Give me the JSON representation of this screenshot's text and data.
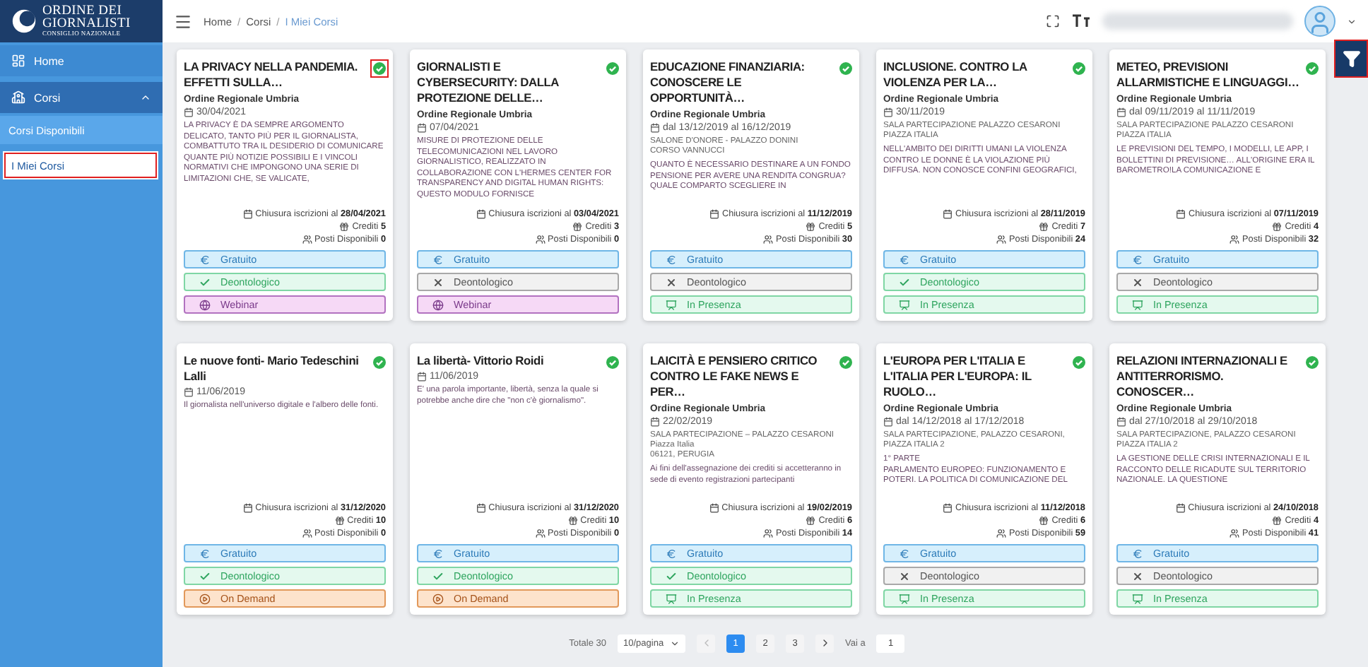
{
  "logo": {
    "lines": [
      "ORDINE DEI",
      "GIORNALISTI",
      "CONSIGLIO NAZIONALE"
    ]
  },
  "sidebar": {
    "items": [
      {
        "kind": "home",
        "label": "Home"
      },
      {
        "kind": "courses",
        "label": "Corsi",
        "expanded": true,
        "children": [
          {
            "label": "Corsi Disponibili",
            "selected": false,
            "highlighted": false
          },
          {
            "label": "I Miei Corsi",
            "selected": true,
            "highlighted": true
          }
        ]
      }
    ]
  },
  "breadcrumb": {
    "separators": [
      "/",
      "/"
    ],
    "items": [
      {
        "label": "Home",
        "current": false
      },
      {
        "label": "Corsi",
        "current": false
      },
      {
        "label": "I Miei Corsi",
        "current": true
      }
    ]
  },
  "filter_button": {
    "highlighted": true
  },
  "cards": [
    {
      "title": "LA PRIVACY NELLA PANDEMIA. EFFETTI SULLA…",
      "completed": true,
      "status_highlighted": true,
      "org": "Ordine Regionale Umbria",
      "date": "30/04/2021",
      "description": "LA PRIVACY È DA SEMPRE ARGOMENTO DELICATO, TANTO PIÙ PER IL GIORNALISTA, COMBATTUTO TRA IL DESIDERIO DI COMUNICARE QUANTE PIÙ NOTIZIE POSSIBILI E I VINCOLI NORMATIVI CHE IMPONGONO UNA SERIE DI LIMITAZIONI CHE, SE VALICATE,",
      "closing_label": "Chiusura iscrizioni al",
      "closing": "28/04/2021",
      "credits_label": "Crediti",
      "credits": "5",
      "seats_label": "Posti Disponibili",
      "seats": "0",
      "tags": [
        {
          "kind": "price",
          "label": "Gratuito"
        },
        {
          "kind": "deontologico",
          "label": "Deontologico",
          "checked": true
        },
        {
          "kind": "webinar",
          "label": "Webinar"
        }
      ]
    },
    {
      "title": "GIORNALISTI E CYBERSECURITY: DALLA PROTEZIONE DELLE…",
      "completed": true,
      "status_highlighted": false,
      "org": "Ordine Regionale Umbria",
      "date": "07/04/2021",
      "description": "MISURE DI PROTEZIONE DELLE TELECOMUNICAZIONI NEL LAVORO GIORNALISTICO, REALIZZATO IN COLLABORAZIONE CON L'HERMES CENTER FOR TRANSPARENCY AND DIGITAL HUMAN RIGHTS: QUESTO MODULO FORNISCE",
      "closing_label": "Chiusura iscrizioni al",
      "closing": "03/04/2021",
      "credits_label": "Crediti",
      "credits": "3",
      "seats_label": "Posti Disponibili",
      "seats": "0",
      "tags": [
        {
          "kind": "price",
          "label": "Gratuito"
        },
        {
          "kind": "deontologico",
          "label": "Deontologico",
          "checked": false
        },
        {
          "kind": "webinar",
          "label": "Webinar"
        }
      ]
    },
    {
      "title": "EDUCAZIONE FINANZIARIA: CONOSCERE LE OPPORTUNITÀ…",
      "completed": true,
      "status_highlighted": false,
      "org": "Ordine Regionale Umbria",
      "date": "dal 13/12/2019 al 16/12/2019",
      "location": [
        "SALONE D'ONORE - PALAZZO DONINI",
        "CORSO VANNUCCI"
      ],
      "description": "QUANTO È NECESSARIO DESTINARE A UN FONDO PENSIONE PER AVERE UNA RENDITA CONGRUA? QUALE COMPARTO SCEGLIERE IN",
      "closing_label": "Chiusura iscrizioni al",
      "closing": "11/12/2019",
      "credits_label": "Crediti",
      "credits": "5",
      "seats_label": "Posti Disponibili",
      "seats": "30",
      "tags": [
        {
          "kind": "price",
          "label": "Gratuito"
        },
        {
          "kind": "deontologico",
          "label": "Deontologico",
          "checked": false
        },
        {
          "kind": "presence",
          "label": "In Presenza"
        }
      ]
    },
    {
      "title": "INCLUSIONE. CONTRO LA VIOLENZA PER LA…",
      "completed": true,
      "status_highlighted": false,
      "org": "Ordine Regionale Umbria",
      "date": "30/11/2019",
      "location": [
        "SALA PARTECIPAZIONE PALAZZO CESARONI",
        "PIAZZA ITALIA"
      ],
      "description": "NELL'AMBITO DEI DIRITTI UMANI LA VIOLENZA CONTRO LE DONNE È LA VIOLAZIONE PIÙ DIFFUSA. NON CONOSCE CONFINI GEOGRAFICI,",
      "closing_label": "Chiusura iscrizioni al",
      "closing": "28/11/2019",
      "credits_label": "Crediti",
      "credits": "7",
      "seats_label": "Posti Disponibili",
      "seats": "24",
      "tags": [
        {
          "kind": "price",
          "label": "Gratuito"
        },
        {
          "kind": "deontologico",
          "label": "Deontologico",
          "checked": true
        },
        {
          "kind": "presence",
          "label": "In Presenza"
        }
      ]
    },
    {
      "title": "METEO, PREVISIONI ALLARMISTICHE E LINGUAGGI…",
      "completed": true,
      "status_highlighted": false,
      "org": "Ordine Regionale Umbria",
      "date": "dal 09/11/2019 al 11/11/2019",
      "location": [
        "SALA PARTECIPAZIONE PALAZZO CESARONI",
        "PIAZZA ITALIA"
      ],
      "description": "LE PREVISIONI DEL TEMPO, I MODELLI, LE APP, I BOLLETTINI DI PREVISIONE… ALL'ORIGINE ERA IL BAROMETRO!LA COMUNICAZIONE E",
      "closing_label": "Chiusura iscrizioni al",
      "closing": "07/11/2019",
      "credits_label": "Crediti",
      "credits": "4",
      "seats_label": "Posti Disponibili",
      "seats": "32",
      "tags": [
        {
          "kind": "price",
          "label": "Gratuito"
        },
        {
          "kind": "deontologico",
          "label": "Deontologico",
          "checked": false
        },
        {
          "kind": "presence",
          "label": "In Presenza"
        }
      ]
    },
    {
      "title": "Le nuove fonti- Mario Tedeschini Lalli",
      "completed": true,
      "status_highlighted": false,
      "date": "11/06/2019",
      "description": "Il giornalista nell'universo digitale e l'albero delle fonti.",
      "closing_label": "Chiusura iscrizioni al",
      "closing": "31/12/2020",
      "credits_label": "Crediti",
      "credits": "10",
      "seats_label": "Posti Disponibili",
      "seats": "0",
      "tags": [
        {
          "kind": "price",
          "label": "Gratuito"
        },
        {
          "kind": "deontologico",
          "label": "Deontologico",
          "checked": true
        },
        {
          "kind": "ondemand",
          "label": "On Demand"
        }
      ]
    },
    {
      "title": "La libertà- Vittorio Roidi",
      "completed": true,
      "status_highlighted": false,
      "date": "11/06/2019",
      "description": "E' una parola importante, libertà, senza la quale si potrebbe anche dire che \"non c'è giornalismo\".",
      "closing_label": "Chiusura iscrizioni al",
      "closing": "31/12/2020",
      "credits_label": "Crediti",
      "credits": "10",
      "seats_label": "Posti Disponibili",
      "seats": "0",
      "tags": [
        {
          "kind": "price",
          "label": "Gratuito"
        },
        {
          "kind": "deontologico",
          "label": "Deontologico",
          "checked": true
        },
        {
          "kind": "ondemand",
          "label": "On Demand"
        }
      ]
    },
    {
      "title": "LAICITÀ E PENSIERO CRITICO CONTRO LE FAKE NEWS E PER…",
      "completed": true,
      "status_highlighted": false,
      "org": "Ordine Regionale Umbria",
      "date": "22/02/2019",
      "location": [
        "SALA PARTECIPAZIONE – PALAZZO CESARONI",
        "Piazza Italia",
        "06121, PERUGIA"
      ],
      "description": "Ai fini dell'assegnazione dei crediti si accetteranno in sede di evento registrazioni partecipanti",
      "closing_label": "Chiusura iscrizioni al",
      "closing": "19/02/2019",
      "credits_label": "Crediti",
      "credits": "6",
      "seats_label": "Posti Disponibili",
      "seats": "14",
      "tags": [
        {
          "kind": "price",
          "label": "Gratuito"
        },
        {
          "kind": "deontologico",
          "label": "Deontologico",
          "checked": true
        },
        {
          "kind": "presence",
          "label": "In Presenza"
        }
      ]
    },
    {
      "title": "L'EUROPA PER L'ITALIA E L'ITALIA PER L'EUROPA: IL RUOLO…",
      "completed": true,
      "status_highlighted": false,
      "org": "Ordine Regionale Umbria",
      "date": "dal 14/12/2018 al 17/12/2018",
      "location": [
        "SALA PARTECIPAZIONE, PALAZZO CESARONI,",
        "PIAZZA ITALIA 2"
      ],
      "description": "1° PARTE\nPARLAMENTO EUROPEO: FUNZIONAMENTO E POTERI. LA POLITICA DI COMUNICAZIONE DEL",
      "closing_label": "Chiusura iscrizioni al",
      "closing": "11/12/2018",
      "credits_label": "Crediti",
      "credits": "6",
      "seats_label": "Posti Disponibili",
      "seats": "59",
      "tags": [
        {
          "kind": "price",
          "label": "Gratuito"
        },
        {
          "kind": "deontologico",
          "label": "Deontologico",
          "checked": false
        },
        {
          "kind": "presence",
          "label": "In Presenza"
        }
      ]
    },
    {
      "title": "RELAZIONI INTERNAZIONALI E ANTITERRORISMO. CONOSCER…",
      "completed": true,
      "status_highlighted": false,
      "org": "Ordine Regionale Umbria",
      "date": "dal 27/10/2018 al 29/10/2018",
      "location": [
        "SALA PARTECIPAZIONE, PALAZZO CESARONI",
        "PIAZZA ITALIA 2"
      ],
      "description": "LA GESTIONE DELLE CRISI INTERNAZIONALI E IL RACCONTO DELLE RICADUTE SUL TERRITORIO NAZIONALE. LA QUESTIONE",
      "closing_label": "Chiusura iscrizioni al",
      "closing": "24/10/2018",
      "credits_label": "Crediti",
      "credits": "4",
      "seats_label": "Posti Disponibili",
      "seats": "41",
      "tags": [
        {
          "kind": "price",
          "label": "Gratuito"
        },
        {
          "kind": "deontologico",
          "label": "Deontologico",
          "checked": false
        },
        {
          "kind": "presence",
          "label": "In Presenza"
        }
      ]
    }
  ],
  "pagination": {
    "total": "Totale 30",
    "page_size": "10/pagina",
    "pages": [
      {
        "label": "1",
        "selected": true
      },
      {
        "label": "2",
        "selected": false
      },
      {
        "label": "3",
        "selected": false
      }
    ],
    "goto_label": "Vai a",
    "goto_value": "1"
  }
}
